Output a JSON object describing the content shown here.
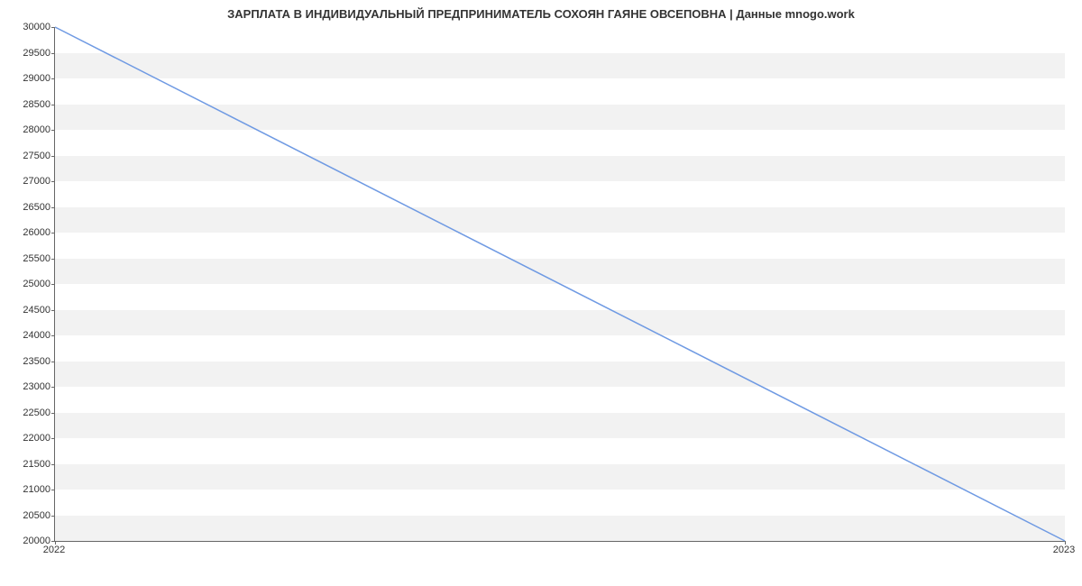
{
  "chart_data": {
    "type": "line",
    "title": "ЗАРПЛАТА В ИНДИВИДУАЛЬНЫЙ ПРЕДПРИНИМАТЕЛЬ СОХОЯН ГАЯНЕ ОВСЕПОВНА | Данные mnogo.work",
    "x": [
      2022,
      2023
    ],
    "values": [
      30000,
      20000
    ],
    "xlabel": "",
    "ylabel": "",
    "x_ticks": [
      2022,
      2023
    ],
    "y_ticks": [
      20000,
      20500,
      21000,
      21500,
      22000,
      22500,
      23000,
      23500,
      24000,
      24500,
      25000,
      25500,
      26000,
      26500,
      27000,
      27500,
      28000,
      28500,
      29000,
      29500,
      30000
    ],
    "xlim": [
      2022,
      2023
    ],
    "ylim": [
      20000,
      30000
    ],
    "line_color": "#6f9ae3"
  }
}
